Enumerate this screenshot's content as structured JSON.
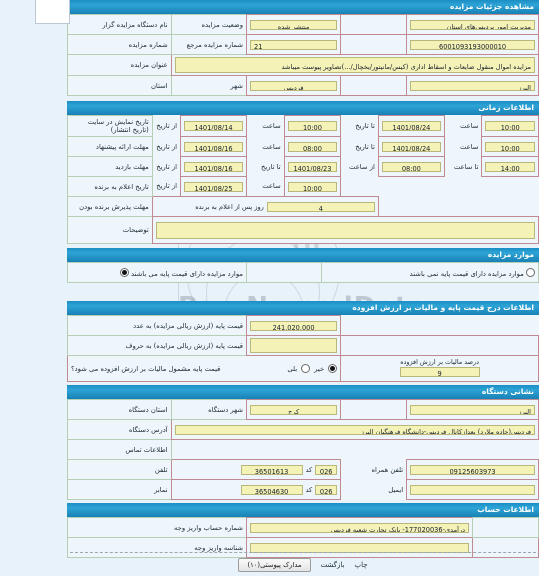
{
  "page": {
    "direction": "rtl",
    "background": "#e8f2fa",
    "accent": "#1e90c4",
    "field_bg": "#f5f2b8"
  },
  "watermark": {
    "brand": "ParsNamadData",
    "digits_line1": "10101",
    "digits_line2": "0001",
    "digits_line3": "010",
    "digits_line4": "10",
    "fa_line1": "طلاعات پارس نماد داده",
    "fa_line2": "پایگاه اطلاع رسانی مناقصه و مزایده",
    "fa_line3": "۰۵-۸۸۳۴۹۴۶۷"
  },
  "sections": {
    "auction_details": {
      "title": "مشاهده جزئیات مزایده",
      "rows": {
        "organizer_label": "نام دستگاه مزایده گزار",
        "organizer_value": "مدیریت امور پردیس‌های استان",
        "status_label": "وضعیت مزایده",
        "status_value": "منتشر شده",
        "auction_no_label": "شماره مزایده",
        "auction_no_value": "6001093193000010",
        "ref_no_label": "شماره مزایده مرجع",
        "ref_no_value": "21",
        "title_label": "عنوان مزایده",
        "title_value": "مزایده اموال منقول ضایعات و اسقاط اداری (کیس/مانیتور/یخچال/...)تصاویر پیوست میباشد",
        "province_label": "استان",
        "province_value": "البرز",
        "city_label": "شهر",
        "city_value": "فردیس"
      }
    },
    "time_info": {
      "title": "اطلاعات زمانی",
      "rows": [
        {
          "label": "تاریخ نمایش در سایت (تاریخ انتشار)",
          "from_tag": "از تاریخ",
          "from_date": "1401/08/14",
          "hour_tag1": "ساعت",
          "from_time": "10:00",
          "to_tag": "تا تاریخ",
          "to_date": "1401/08/24",
          "hour_tag2": "ساعت",
          "to_time": "10:00"
        },
        {
          "label": "مهلت ارائه پیشنهاد",
          "from_tag": "از تاریخ",
          "from_date": "1401/08/16",
          "hour_tag1": "ساعت",
          "from_time": "08:00",
          "to_tag": "تا تاریخ",
          "to_date": "1401/08/24",
          "hour_tag2": "ساعت",
          "to_time": "10:00"
        },
        {
          "label": "مهلت بازدید",
          "from_tag": "از تاریخ",
          "from_date": "1401/08/16",
          "hour_tag1": "تا تاریخ",
          "from_time": "1401/08/23",
          "to_tag": "از ساعت",
          "to_date": "08:00",
          "hour_tag2": "تا ساعت",
          "to_time": "14:00"
        }
      ],
      "announce_label": "تاریخ اعلام به برنده",
      "announce_from_tag": "از تاریخ",
      "announce_date": "1401/08/25",
      "announce_hour_tag": "ساعت",
      "announce_time": "10:00",
      "accept_label": "مهلت پذیرش برنده بودن",
      "accept_value": "4",
      "accept_suffix": "روز پس از اعلام به برنده",
      "notes_label": "توضیحات",
      "notes_value": ""
    },
    "auction_items": {
      "title": "موارد مزایده",
      "option_with_base": "موارد مزایده دارای قیمت پایه می باشند",
      "option_without_base": "موارد مزایده دارای قیمت پایه نمی باشند",
      "selected": "with_base"
    },
    "price_tax": {
      "title": "اطلاعات درج قیمت پایه و مالیات بر ارزش افزوده",
      "base_price_label": "قیمت پایه (ارزش ریالی مزایده) به عدد",
      "base_price_value": "241,020,000",
      "base_price_words_label": "قیمت پایه (ارزش ریالی مزایده) به حروف",
      "base_price_words_value": "",
      "vat_question": "قیمت پایه مشمول مالیات بر ارزش افزوده می شود؟",
      "vat_yes": "بلی",
      "vat_no": "خیر",
      "vat_selected": "no",
      "vat_percent_label": "درصد مالیات بر ارزش افزوده",
      "vat_percent_value": "9"
    },
    "device_location": {
      "title": "نشانی دستگاه",
      "province_label": "استان دستگاه",
      "province_value": "البرز",
      "city_label": "شهر دستگاه",
      "city_value": "کرج",
      "address_label": "آدرس دستگاه",
      "address_value": "فردیس(جاده ملارد) بعدازکانال فردیس-دانشگاه فرهنگیان البرز",
      "contact_label": "اطلاعات تماس",
      "phone_label": "تلفن",
      "phone_code_tag": "کد",
      "phone_code": "026",
      "phone_number": "36501613",
      "mobile_label": "تلفن همراه",
      "mobile_number": "09125603973",
      "fax_label": "نمابر",
      "fax_code_tag": "کد",
      "fax_code": "026",
      "fax_number": "36504630",
      "email_label": "ایمیل",
      "email_value": ""
    },
    "account_info": {
      "title": "اطلاعات حساب",
      "account_no_label": "شماره حساب واریز وجه",
      "account_no_value": "درآمدی-177020036- بانک تجارت شعبه فردیس",
      "iban_label": "شناسه واریز وجه",
      "iban_value": ""
    }
  },
  "footer": {
    "attachments_button": "مدارک پیوستی(۱۰)",
    "back_link": "بازگشت",
    "print_link": "چاپ"
  }
}
